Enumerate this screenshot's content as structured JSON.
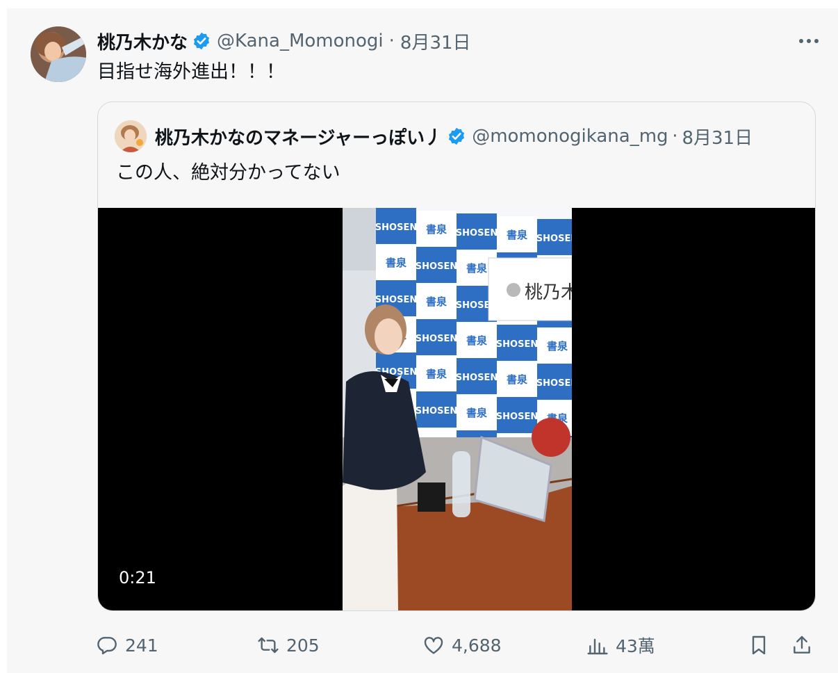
{
  "tweet": {
    "display_name": "桃乃木かな",
    "handle": "@Kana_Momonogi",
    "separator": "·",
    "date": "8月31日",
    "text": "目指せ海外進出！！！"
  },
  "quote": {
    "display_name": "桃乃木かなのマネージャーっぽい丿",
    "handle": "@momonogikana_mg",
    "separator": "·",
    "date": "8月31日",
    "text": "この人、絶対分かってない",
    "video": {
      "duration": "0:21",
      "backdrop_labels": [
        "SHOSEN",
        "書泉"
      ],
      "sign_text": "桃乃木か"
    }
  },
  "actions": {
    "replies": "241",
    "retweets": "205",
    "likes": "4,688",
    "views": "43萬"
  },
  "colors": {
    "verified": "#1d9bf0",
    "secondary_text": "#536471",
    "border": "#cfd9de",
    "shosen_blue": "#2e6fc4"
  },
  "icons": [
    "verified-badge-icon",
    "more-icon",
    "reply-icon",
    "retweet-icon",
    "like-icon",
    "views-icon",
    "bookmark-icon",
    "share-icon"
  ]
}
